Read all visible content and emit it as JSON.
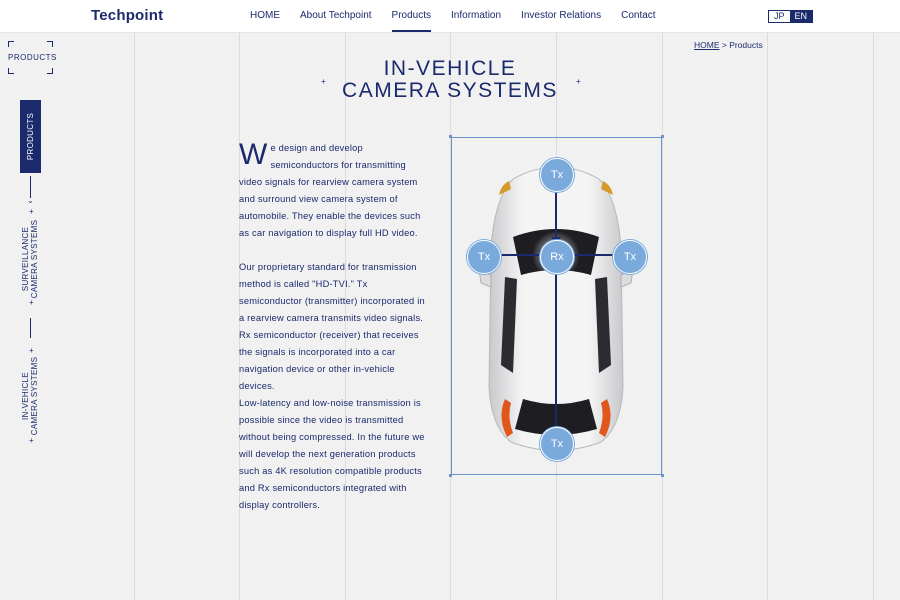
{
  "header": {
    "logo": "Techpoint",
    "nav": [
      "HOME",
      "About Techpoint",
      "Products",
      "Information",
      "Investor Relations",
      "Contact"
    ],
    "active_nav": "Products",
    "lang": {
      "jp": "JP",
      "en": "EN",
      "active": "EN"
    }
  },
  "sidebar": {
    "section_title": "PRODUCTS",
    "tabs": [
      {
        "label": "PRODUCTS",
        "active": true
      },
      {
        "label_line1": "SURVEILLANCE",
        "label_line2": "CAMERA SYSTEMS"
      },
      {
        "label_line1": "IN-VEHICLE",
        "label_line2": "CAMERA SYSTEMS"
      }
    ]
  },
  "breadcrumb": {
    "home": "HOME",
    "sep": " > ",
    "current": "Products"
  },
  "page": {
    "title_line1": "IN-VEHICLE",
    "title_line2": "CAMERA SYSTEMS",
    "dropcap": "W",
    "para1": "e design and develop semiconductors for transmitting video signals for rearview camera system and surround view camera system of automobile. They enable the devices such as car navigation to display full HD video.",
    "para2": "Our proprietary standard for transmission method is called \"HD-TVI.\" Tx semiconductor (transmitter) incorporated in a rearview camera transmits video signals. Rx semiconductor (receiver) that receives the signals is incorporated into a car navigation device or other in-vehicle devices.",
    "para3": "Low-latency and low-noise transmission is possible since the video is transmitted without being compressed. In the future we will develop the next generation products such as 4K resolution compatible products and Rx semiconductors integrated with display controllers."
  },
  "diagram": {
    "receiver": "Rx",
    "transmitters": [
      "Tx",
      "Tx",
      "Tx",
      "Tx"
    ],
    "colors": {
      "node": "#7aa9db",
      "line": "#1a2a6c",
      "frame": "#6d93c9"
    }
  }
}
